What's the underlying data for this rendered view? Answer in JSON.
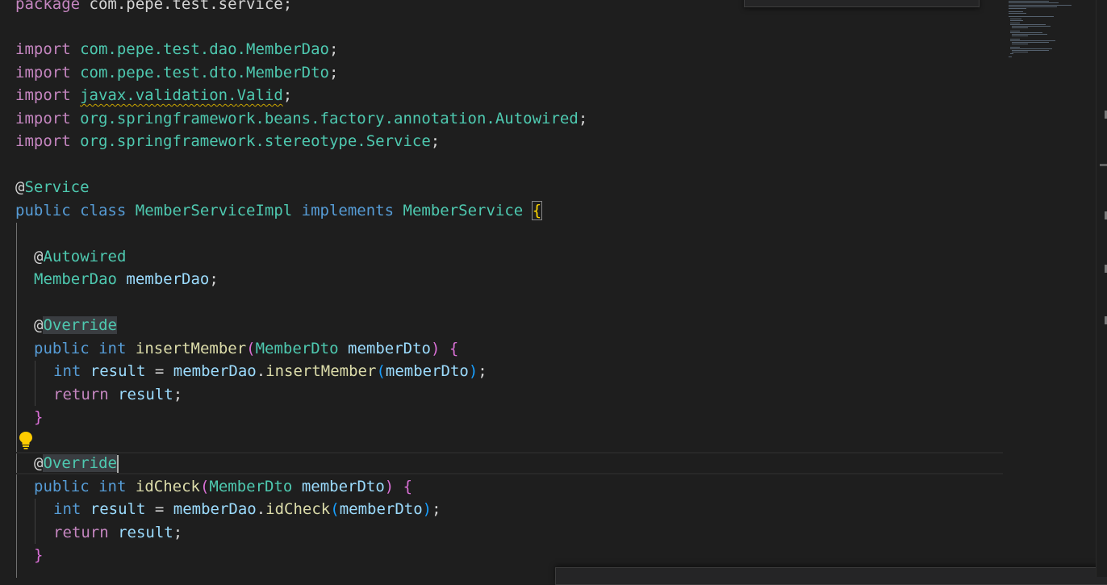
{
  "editor": {
    "language": "java",
    "theme": {
      "background": "#1e1e1e",
      "keyword": "#569cd6",
      "control_keyword": "#c586c0",
      "type": "#4ec9b0",
      "variable": "#9cdcfe",
      "function": "#dcdcaa",
      "bracket_level1": "#ffd700",
      "bracket_level2": "#da70d6",
      "bracket_level3": "#179fff",
      "warning_squiggle": "#cca700"
    },
    "code": {
      "package_line": {
        "kw": "package",
        "name": "com.pepe.test.service",
        "semi": ";"
      },
      "imports": [
        {
          "kw": "import",
          "path": "com.pepe.test.dao.",
          "name": "MemberDao",
          "semi": ";"
        },
        {
          "kw": "import",
          "path": "com.pepe.test.dto.",
          "name": "MemberDto",
          "semi": ";"
        },
        {
          "kw": "import",
          "path": "javax.validation.",
          "name": "Valid",
          "semi": ";"
        },
        {
          "kw": "import",
          "path": "org.springframework.beans.factory.annotation.",
          "name": "Autowired",
          "semi": ";"
        },
        {
          "kw": "import",
          "path": "org.springframework.stereotype.",
          "name": "Service",
          "semi": ";"
        }
      ],
      "class_annotation": {
        "at": "@",
        "name": "Service"
      },
      "class_decl": {
        "mod": "public",
        "kw": "class",
        "name": "MemberServiceImpl",
        "impl": "implements",
        "iface": "MemberService",
        "brace": "{"
      },
      "field_annotation": {
        "at": "@",
        "name": "Autowired"
      },
      "field": {
        "type": "MemberDao",
        "name": "memberDao",
        "semi": ";"
      },
      "methods": [
        {
          "annotation": {
            "at": "@",
            "name": "Override"
          },
          "sig": {
            "mod": "public",
            "ret": "int",
            "name": "insertMember",
            "lp": "(",
            "ptype": "MemberDto",
            "pname": "memberDto",
            "rp": ")",
            "brace": "{"
          },
          "body1": {
            "type": "int",
            "var": "result",
            "eq": " = ",
            "obj": "memberDao",
            "dot": ".",
            "call": "insertMember",
            "lp": "(",
            "arg": "memberDto",
            "rp": ")",
            "semi": ";"
          },
          "body2": {
            "kw": "return",
            "var": "result",
            "semi": ";"
          },
          "close": "}"
        },
        {
          "annotation": {
            "at": "@",
            "name": "Override"
          },
          "sig": {
            "mod": "public",
            "ret": "int",
            "name": "idCheck",
            "lp": "(",
            "ptype": "MemberDto",
            "pname": "memberDto",
            "rp": ")",
            "brace": "{"
          },
          "body1": {
            "type": "int",
            "var": "result",
            "eq": " = ",
            "obj": "memberDao",
            "dot": ".",
            "call": "idCheck",
            "lp": "(",
            "arg": "memberDto",
            "rp": ")",
            "semi": ";"
          },
          "body2": {
            "kw": "return",
            "var": "result",
            "semi": ";"
          },
          "close": "}"
        }
      ]
    }
  },
  "icons": {
    "lightbulb": "lightbulb-icon"
  }
}
